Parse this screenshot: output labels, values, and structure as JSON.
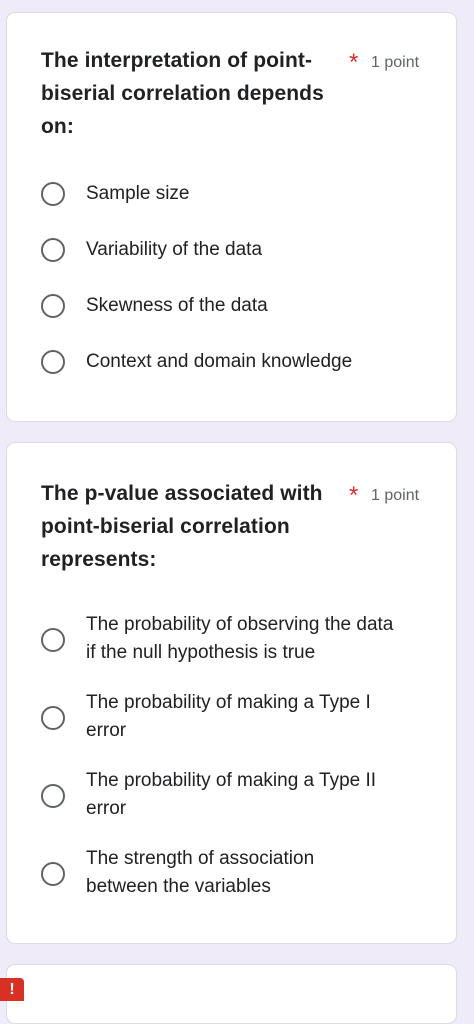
{
  "questions": [
    {
      "title": "The interpretation of point-biserial correlation depends on:",
      "required_mark": "*",
      "points": "1 point",
      "options": [
        "Sample size",
        "Variability of the data",
        "Skewness of the data",
        "Context and domain knowledge"
      ]
    },
    {
      "title": "The p-value associated with point-biserial correlation represents:",
      "required_mark": "*",
      "points": "1 point",
      "options": [
        "The probability of observing the data if the null hypothesis is true",
        "The probability of making a Type I error",
        "The probability of making a Type II error",
        "The strength of association between the variables"
      ]
    }
  ],
  "error_badge": "!",
  "colors": {
    "page_background": "#f0ebf8",
    "card_background": "#ffffff",
    "required_star": "#d93025",
    "radio_border": "#5f6368"
  }
}
